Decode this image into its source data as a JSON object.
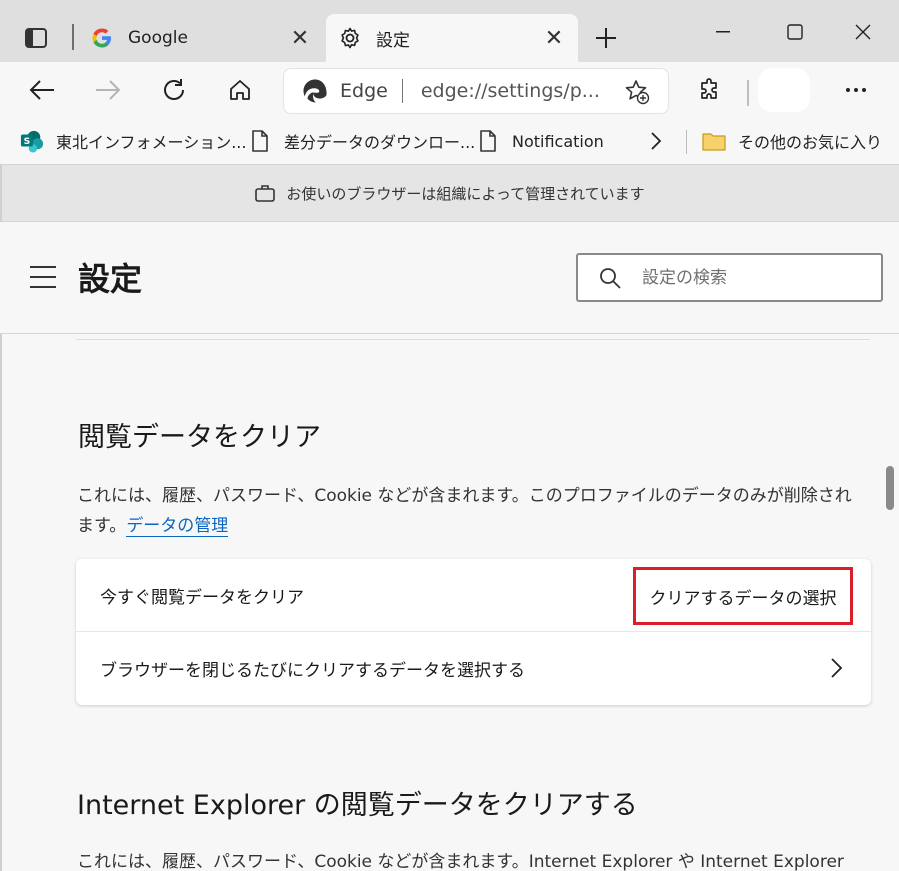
{
  "tabs": [
    {
      "label": "Google",
      "icon": "google-icon"
    },
    {
      "label": "設定",
      "icon": "gear-icon"
    }
  ],
  "address_bar": {
    "site_label": "Edge",
    "url": "edge://settings/p..."
  },
  "favorites": [
    {
      "label": "東北インフォメーション...",
      "icon": "sharepoint-icon"
    },
    {
      "label": "差分データのダウンロー...",
      "icon": "page-icon"
    },
    {
      "label": "Notification",
      "icon": "page-icon"
    },
    {
      "label": "その他のお気に入り",
      "icon": "folder-icon"
    }
  ],
  "banner": {
    "text": "お使いのブラウザーは組織によって管理されています"
  },
  "settings": {
    "title": "設定",
    "search_placeholder": "設定の検索"
  },
  "clear_section": {
    "title": "閲覧データをクリア",
    "description": "これには、履歴、パスワード、Cookie などが含まれます。このプロファイルのデータのみが削除されます。",
    "manage_link": "データの管理",
    "row1_label": "今すぐ閲覧データをクリア",
    "row1_button": "クリアするデータの選択",
    "row2_label": "ブラウザーを閉じるたびにクリアするデータを選択する"
  },
  "ie_section": {
    "title": "Internet Explorer の閲覧データをクリアする",
    "description": "これには、履歴、パスワード、Cookie などが含まれます。Internet Explorer や Internet Explorer"
  },
  "colors": {
    "highlight_border": "#d9202a",
    "link": "#0a66c2"
  }
}
